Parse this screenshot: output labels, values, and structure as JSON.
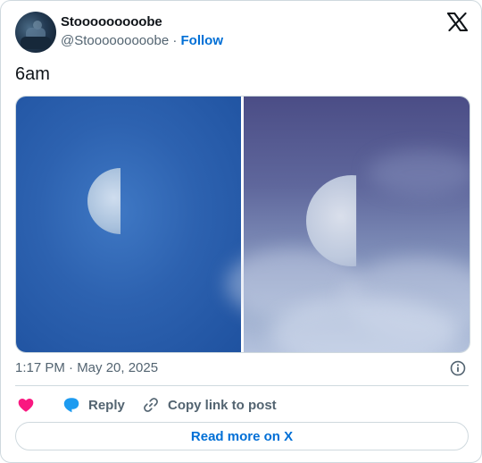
{
  "author": {
    "display_name": "Stooooooooobe",
    "handle": "@Stooooooooobe",
    "separator": "·",
    "follow_label": "Follow"
  },
  "tweet": {
    "text": "6am",
    "timestamp": "1:17 PM · May 20, 2025"
  },
  "actions": {
    "reply_label": "Reply",
    "copy_link_label": "Copy link to post",
    "read_more_label": "Read more on X"
  },
  "icons": {
    "brand": "x-logo-icon",
    "like": "heart-icon",
    "reply": "speech-bubble-icon",
    "copy": "link-icon",
    "info": "info-icon"
  },
  "colors": {
    "text_primary": "#0f1419",
    "text_secondary": "#536471",
    "link_blue": "#006fd6",
    "like_pink": "#f91880",
    "reply_blue": "#1d9bf0",
    "border": "#cfd9de"
  }
}
